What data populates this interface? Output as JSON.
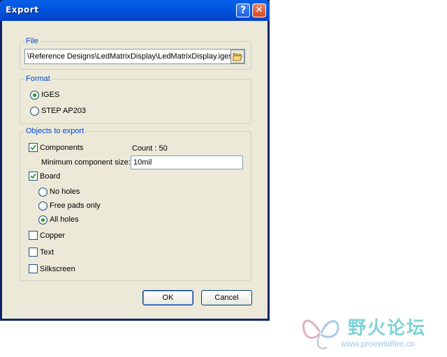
{
  "window": {
    "title": "Export",
    "help_label": "?",
    "close_label": "✕"
  },
  "file": {
    "legend": "File",
    "path": "\\Reference Designs\\LedMatrixDisplay\\LedMatrixDisplay.iges",
    "browse_icon": "folder-open-icon"
  },
  "format": {
    "legend": "Format",
    "options": [
      {
        "label": "IGES",
        "selected": true
      },
      {
        "label": "STEP AP203",
        "selected": false
      }
    ]
  },
  "objects": {
    "legend": "Objects to export",
    "components_label": "Components",
    "components_checked": true,
    "count_label": "Count : 50",
    "min_size_label": "Minimum component size:",
    "min_size_value": "10mil",
    "board_label": "Board",
    "board_checked": true,
    "holes_options": [
      {
        "label": "No holes",
        "selected": false
      },
      {
        "label": "Free pads only",
        "selected": false
      },
      {
        "label": "All holes",
        "selected": true
      }
    ],
    "copper_label": "Copper",
    "copper_checked": false,
    "text_label": "Text",
    "text_checked": false,
    "silkscreen_label": "Silkscreen",
    "silkscreen_checked": false
  },
  "buttons": {
    "ok": "OK",
    "cancel": "Cancel"
  },
  "watermark": {
    "name": "野火论坛",
    "url": "www.proewildfire.cn"
  },
  "colors": {
    "title_bar": "#0058e0",
    "dialog_bg": "#ece9d8",
    "legend": "#0046d5",
    "radio_dot": "#21a121"
  }
}
